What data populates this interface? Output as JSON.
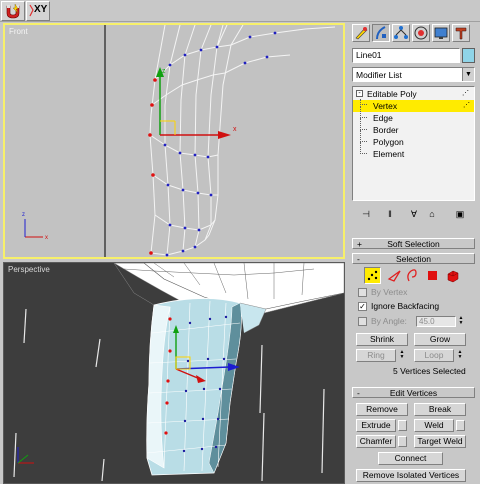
{
  "toolbar": {
    "buttons": [
      {
        "icon": "magnet-snap-icon"
      },
      {
        "icon": "xy-constraint-icon",
        "label": "XY"
      }
    ]
  },
  "viewports": {
    "front": {
      "label": "Front",
      "border_color": "#f7f06a"
    },
    "perspective": {
      "label": "Perspective"
    }
  },
  "command_panel": {
    "tabs": [
      {
        "icon": "create-icon"
      },
      {
        "icon": "modify-icon",
        "active": true
      },
      {
        "icon": "hierarchy-icon"
      },
      {
        "icon": "motion-icon"
      },
      {
        "icon": "display-icon"
      },
      {
        "icon": "utilities-icon"
      }
    ],
    "object_name": "Line01",
    "object_color": "#8fd4e8",
    "modifier_list": "Modifier List",
    "stack": {
      "root": "Editable Poly",
      "items": [
        "Vertex",
        "Edge",
        "Border",
        "Polygon",
        "Element"
      ],
      "selected": "Vertex",
      "highlight_color": "#ffeb00"
    },
    "stack_tools": [
      "pin-stack-icon",
      "show-end-result-icon",
      "make-unique-icon",
      "remove-modifier-icon",
      "configure-modifier-sets-icon"
    ],
    "soft_selection": {
      "title": "Soft Selection",
      "sign": "+"
    },
    "selection": {
      "title": "Selection",
      "sign": "-",
      "level_icons": [
        "vertex-level-icon",
        "edge-level-icon",
        "border-level-icon",
        "polygon-level-icon",
        "element-level-icon"
      ],
      "by_vertex": {
        "label": "By Vertex",
        "checked": false
      },
      "ignore_backfacing": {
        "label": "Ignore Backfacing",
        "checked": true
      },
      "by_angle": {
        "label": "By Angle:",
        "checked": false,
        "value": "45.0"
      },
      "shrink": "Shrink",
      "grow": "Grow",
      "ring": "Ring",
      "loop": "Loop",
      "status": "5 Vertices Selected"
    },
    "edit_vertices": {
      "title": "Edit Vertices",
      "sign": "-",
      "remove": "Remove",
      "break": "Break",
      "extrude": "Extrude",
      "weld": "Weld",
      "chamfer": "Chamfer",
      "target_weld": "Target Weld",
      "connect": "Connect",
      "remove_isolated": "Remove Isolated Vertices"
    }
  }
}
